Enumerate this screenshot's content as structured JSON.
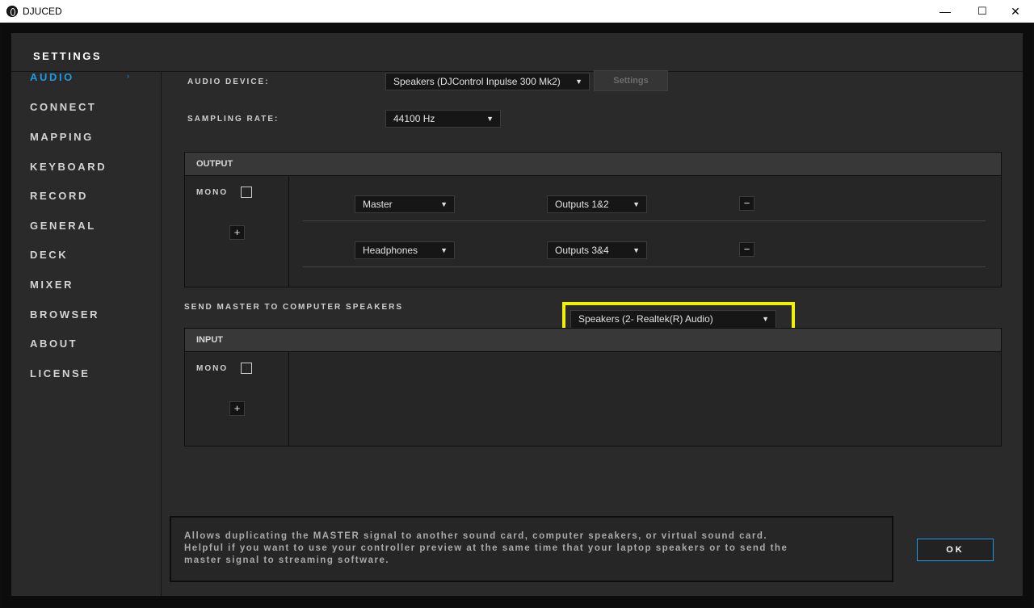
{
  "window": {
    "title": "DJUCED",
    "minimize": "—",
    "maximize": "☐",
    "close": "✕"
  },
  "header": {
    "title": "SETTINGS"
  },
  "sidebar": {
    "items": [
      {
        "label": "AUDIO",
        "active": true
      },
      {
        "label": "CONNECT"
      },
      {
        "label": "MAPPING"
      },
      {
        "label": "KEYBOARD"
      },
      {
        "label": "RECORD"
      },
      {
        "label": "GENERAL"
      },
      {
        "label": "DECK"
      },
      {
        "label": "MIXER"
      },
      {
        "label": "BROWSER"
      },
      {
        "label": "ABOUT"
      },
      {
        "label": "LICENSE"
      }
    ],
    "active_arrow": "›"
  },
  "audio": {
    "device_label": "AUDIO DEVICE:",
    "device_value": "Speakers (DJControl Inpulse 300 Mk2)",
    "settings_button": "Settings",
    "sampling_label": "SAMPLING RATE:",
    "sampling_value": "44100 Hz"
  },
  "output": {
    "header": "OUTPUT",
    "mono_label": "MONO",
    "add_button": "+",
    "routes": [
      {
        "source": "Master",
        "target": "Outputs 1&2",
        "remove": "−"
      },
      {
        "source": "Headphones",
        "target": "Outputs 3&4",
        "remove": "−"
      }
    ]
  },
  "send_master": {
    "label": "SEND MASTER TO COMPUTER SPEAKERS",
    "value": "Speakers (2- Realtek(R) Audio)",
    "highlight_color": "#f0f000"
  },
  "input": {
    "header": "INPUT",
    "mono_label": "MONO",
    "add_button": "+"
  },
  "info": {
    "lines": [
      "Allows duplicating the MASTER signal to another sound card, computer speakers, or virtual sound card.",
      "Helpful if you want to use your controller preview at the same time that your laptop speakers or to send the",
      "master signal to streaming software."
    ]
  },
  "ok_button": "OK",
  "caret": "▼",
  "colors": {
    "accent": "#1e9ae0",
    "background": "#2a2a2a"
  }
}
